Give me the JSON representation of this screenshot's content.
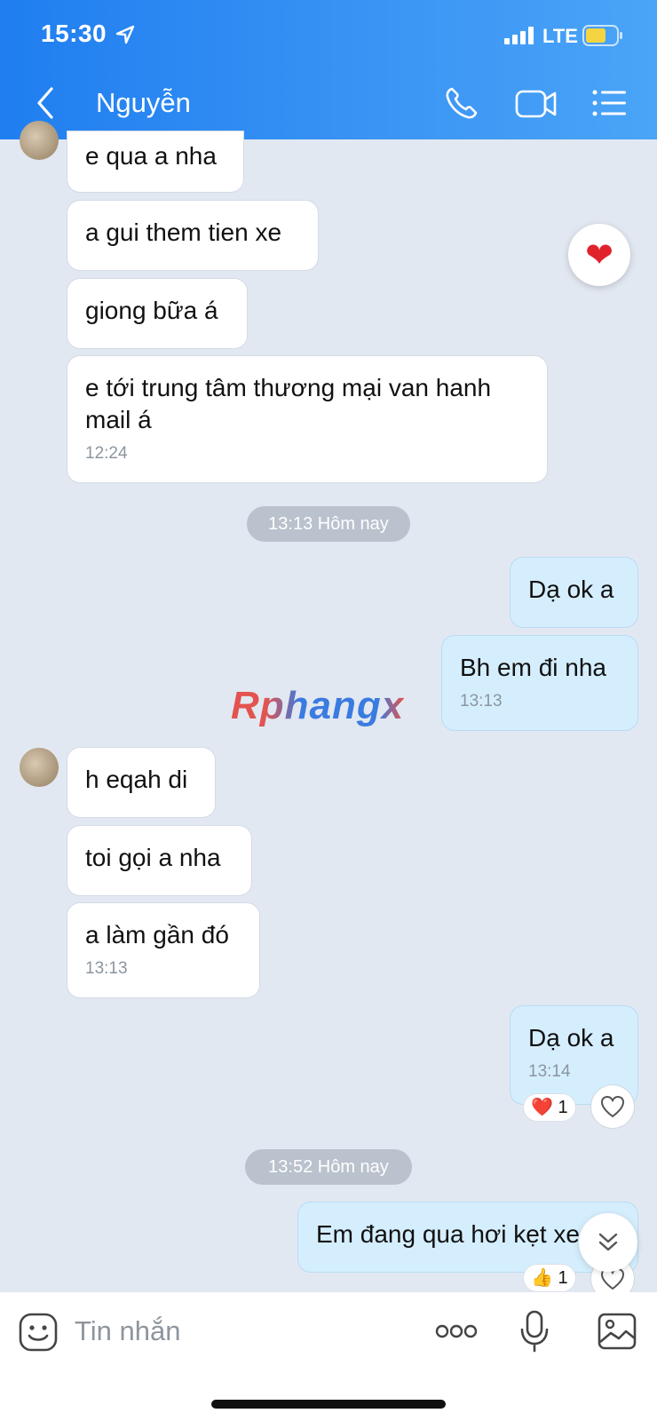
{
  "status_bar": {
    "time": "15:30",
    "network": "LTE"
  },
  "header": {
    "title": "Nguyễn"
  },
  "messages": [
    {
      "text": "e qua a nha"
    },
    {
      "text": "a gui them tien xe"
    },
    {
      "text": "giong bữa á"
    },
    {
      "text": "e tới trung tâm thương mại van hanh mail á",
      "time": "12:24"
    },
    {
      "text": "Dạ ok a"
    },
    {
      "text": "Bh em đi nha",
      "time": "13:13"
    },
    {
      "text": "h eqah di"
    },
    {
      "text": "toi gọi a nha"
    },
    {
      "text": "a làm gần đó",
      "time": "13:13"
    },
    {
      "text": "Dạ ok a",
      "time": "13:14",
      "reaction": "❤️",
      "reaction_count": "1"
    },
    {
      "text": "Em đang qua hơi kẹt xe",
      "reaction": "👍",
      "reaction_count": "1"
    }
  ],
  "dividers": [
    {
      "label": "13:13 Hôm nay"
    },
    {
      "label": "13:52 Hôm nay"
    }
  ],
  "watermark": "Rphangx",
  "floating_reaction": "❤",
  "composer": {
    "placeholder": "Tin nhắn"
  },
  "colors": {
    "header": "#2e8cf2",
    "my_bubble": "#d5eefe",
    "background": "#e2e8f1"
  }
}
